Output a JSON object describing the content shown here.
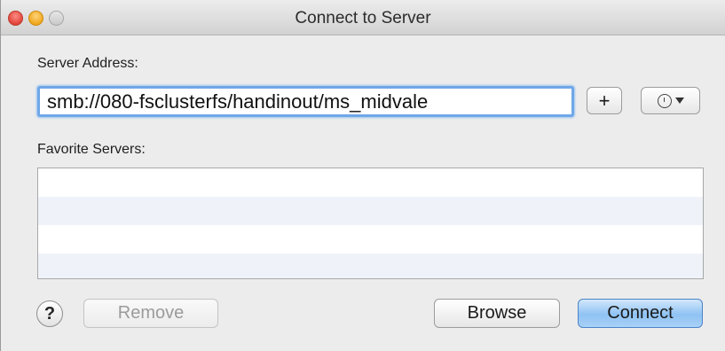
{
  "window": {
    "title": "Connect to Server"
  },
  "server_address": {
    "label": "Server Address:",
    "value": "smb://080-fsclusterfs/handinout/ms_midvale",
    "add_label": "+",
    "recent_icon": "clock-icon"
  },
  "favorites": {
    "label": "Favorite Servers:",
    "rows": [
      "",
      "",
      "",
      ""
    ]
  },
  "buttons": {
    "help_label": "?",
    "remove_label": "Remove",
    "browse_label": "Browse",
    "connect_label": "Connect"
  },
  "colors": {
    "focus_ring": "#6fa7e8",
    "default_button": "#8fc2f3"
  }
}
